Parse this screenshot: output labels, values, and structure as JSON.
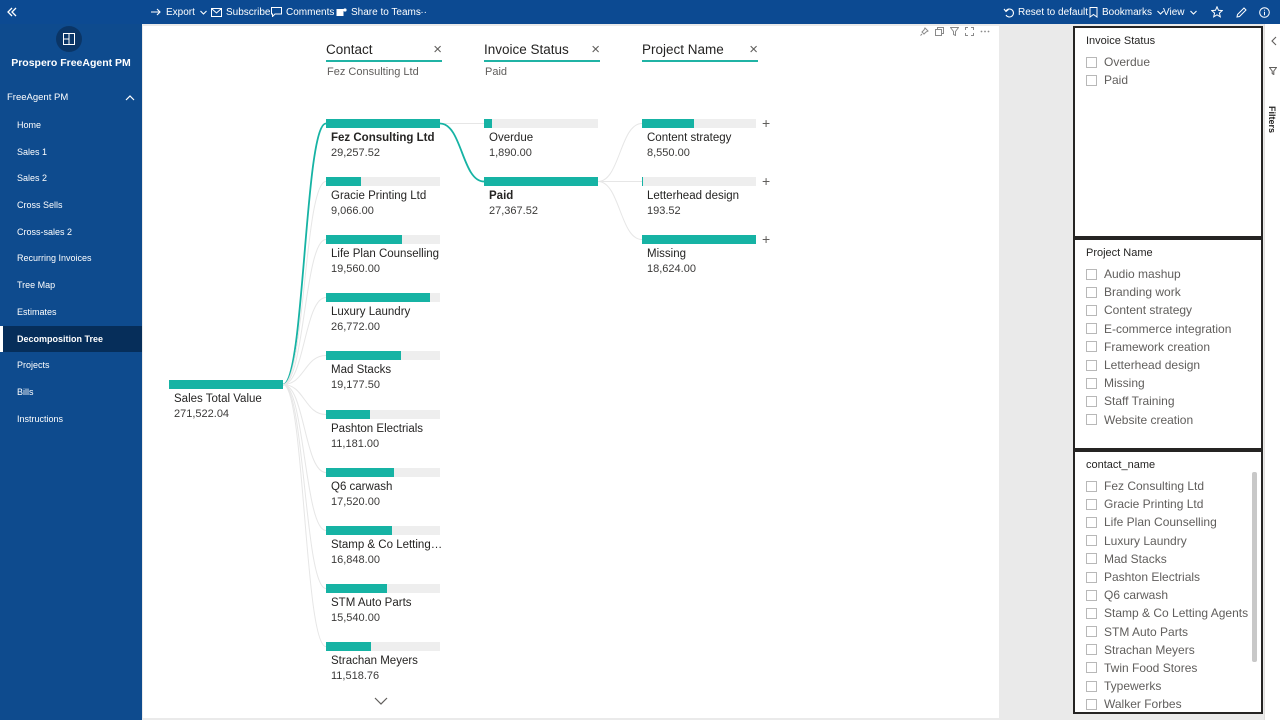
{
  "topbar": {
    "export": "Export",
    "subscribe": "Subscribe",
    "comments": "Comments",
    "share": "Share to Teams",
    "more": "···",
    "reset": "Reset to default",
    "bookmarks": "Bookmarks",
    "view": "View"
  },
  "sidebar": {
    "app_title": "Prospero FreeAgent PM",
    "section": "FreeAgent PM",
    "items": [
      {
        "label": "Home"
      },
      {
        "label": "Sales 1"
      },
      {
        "label": "Sales 2"
      },
      {
        "label": "Cross Sells"
      },
      {
        "label": "Cross-sales 2"
      },
      {
        "label": "Recurring Invoices"
      },
      {
        "label": "Tree Map"
      },
      {
        "label": "Estimates"
      },
      {
        "label": "Decomposition Tree",
        "active": true
      },
      {
        "label": "Projects"
      },
      {
        "label": "Bills"
      },
      {
        "label": "Instructions"
      }
    ]
  },
  "tree": {
    "root": {
      "label": "Sales Total Value",
      "value": "271,522.04",
      "fraction": 1.0
    },
    "levels": [
      {
        "title": "Contact",
        "filter": "Fez Consulting Ltd"
      },
      {
        "title": "Invoice Status",
        "filter": "Paid"
      },
      {
        "title": "Project Name",
        "filter": ""
      }
    ],
    "contacts": [
      {
        "label": "Fez Consulting Ltd",
        "value": "29,257.52",
        "fraction": 1.0,
        "selected": true
      },
      {
        "label": "Gracie Printing Ltd",
        "value": "9,066.00",
        "fraction": 0.31
      },
      {
        "label": "Life Plan Counselling",
        "value": "19,560.00",
        "fraction": 0.669
      },
      {
        "label": "Luxury Laundry",
        "value": "26,772.00",
        "fraction": 0.915
      },
      {
        "label": "Mad Stacks",
        "value": "19,177.50",
        "fraction": 0.655
      },
      {
        "label": "Pashton Electrials",
        "value": "11,181.00",
        "fraction": 0.382
      },
      {
        "label": "Q6 carwash",
        "value": "17,520.00",
        "fraction": 0.599
      },
      {
        "label": "Stamp & Co Letting A...",
        "value": "16,848.00",
        "fraction": 0.576
      },
      {
        "label": "STM Auto Parts",
        "value": "15,540.00",
        "fraction": 0.531
      },
      {
        "label": "Strachan Meyers",
        "value": "11,518.76",
        "fraction": 0.394
      }
    ],
    "statuses": [
      {
        "label": "Overdue",
        "value": "1,890.00",
        "fraction": 0.069
      },
      {
        "label": "Paid",
        "value": "27,367.52",
        "fraction": 1.0,
        "selected": true
      }
    ],
    "projects": [
      {
        "label": "Content strategy",
        "value": "8,550.00",
        "fraction": 0.459
      },
      {
        "label": "Letterhead design",
        "value": "193.52",
        "fraction": 0.0104
      },
      {
        "label": "Missing",
        "value": "18,624.00",
        "fraction": 1.0
      }
    ],
    "expand_symbol": "+"
  },
  "slicers": {
    "invoice_status": {
      "title": "Invoice Status",
      "items": [
        "Overdue",
        "Paid"
      ]
    },
    "project_name": {
      "title": "Project Name",
      "items": [
        "Audio mashup",
        "Branding work",
        "Content strategy",
        "E-commerce integration",
        "Framework creation",
        "Letterhead design",
        "Missing",
        "Staff Training",
        "Website creation"
      ]
    },
    "contact_name": {
      "title": "contact_name",
      "items": [
        "Fez Consulting Ltd",
        "Gracie Printing Ltd",
        "Life Plan Counselling",
        "Luxury Laundry",
        "Mad Stacks",
        "Pashton Electrials",
        "Q6 carwash",
        "Stamp & Co Letting Agents",
        "STM Auto Parts",
        "Strachan Meyers",
        "Twin Food Stores",
        "Typewerks",
        "Walker Forbes"
      ]
    }
  },
  "filters_pane": {
    "label": "Filters"
  },
  "colors": {
    "accent": "#16b3a4",
    "topbar": "#0c4a92",
    "sidebar": "#0e4b8e",
    "active_nav": "#062e5a"
  }
}
